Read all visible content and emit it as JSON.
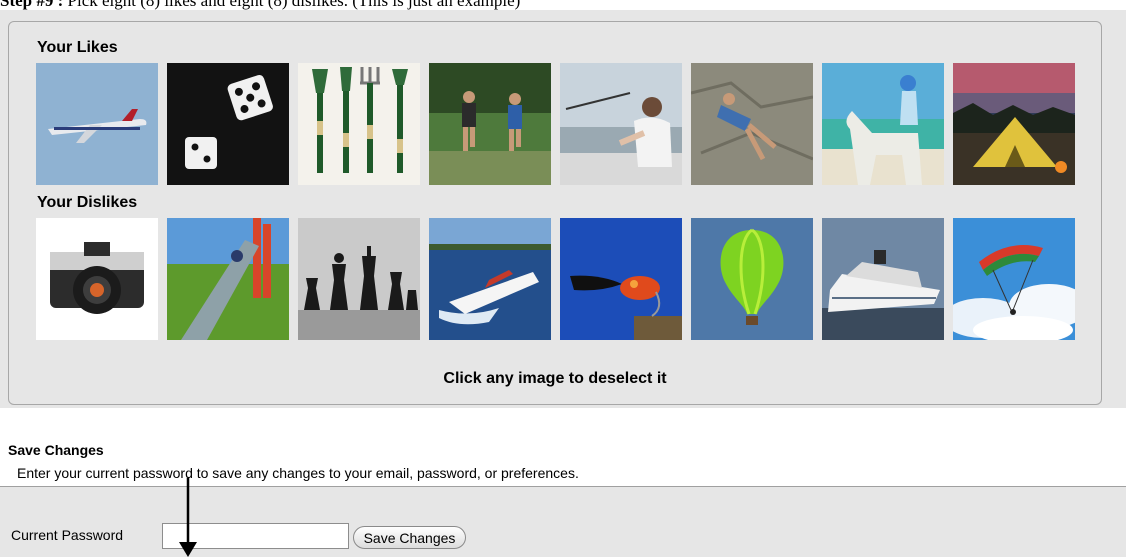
{
  "doc": {
    "step_bold": "Step #9 :",
    "step_text": " Pick eight (8) likes and eight (8) dislikes.  (This is just an example)"
  },
  "likes": {
    "title": "Your Likes",
    "icons": [
      "airplane-icon",
      "dice-icon",
      "garden-tools-icon",
      "joggers-icon",
      "fishing-icon",
      "rock-climbing-icon",
      "horseback-riding-icon",
      "camping-tent-icon"
    ]
  },
  "dislikes": {
    "title": "Your Dislikes",
    "icons": [
      "camera-icon",
      "playground-slide-icon",
      "chess-pieces-icon",
      "speedboat-icon",
      "fishing-fly-icon",
      "hot-air-balloon-icon",
      "cruise-ship-icon",
      "parasailing-icon"
    ]
  },
  "panel": {
    "hint": "Click any image to deselect it"
  },
  "save": {
    "title": "Save Changes",
    "description": "Enter your current password to save any changes to your email, password, or preferences.",
    "password_label": "Current Password",
    "password_value": "",
    "button_label": "Save Changes"
  }
}
